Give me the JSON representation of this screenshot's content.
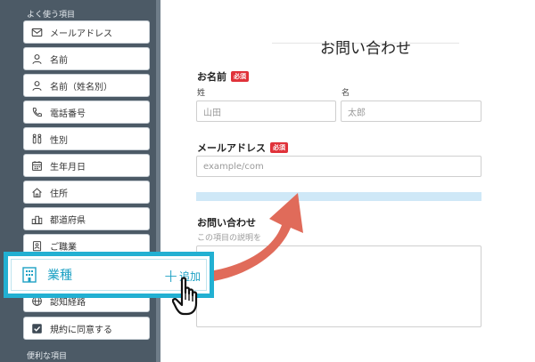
{
  "sidebar": {
    "frequent_heading": "よく使う項目",
    "useful_heading": "便利な項目",
    "items": [
      {
        "label": "メールアドレス",
        "icon": "mail-icon"
      },
      {
        "label": "名前",
        "icon": "person-icon"
      },
      {
        "label": "名前（姓名別）",
        "icon": "person-icon"
      },
      {
        "label": "電話番号",
        "icon": "phone-icon"
      },
      {
        "label": "性別",
        "icon": "gender-icon"
      },
      {
        "label": "生年月日",
        "icon": "calendar-icon"
      },
      {
        "label": "住所",
        "icon": "home-icon"
      },
      {
        "label": "都道府県",
        "icon": "city-icon"
      },
      {
        "label": "ご職業",
        "icon": "badge-icon"
      },
      {
        "label": "業種",
        "icon": "building-icon"
      },
      {
        "label": "認知経路",
        "icon": "globe-icon"
      },
      {
        "label": "規約に同意する",
        "icon": "checkbox-icon"
      }
    ]
  },
  "drag_card": {
    "label": "業種",
    "add_plus": "+",
    "add_label": "追加",
    "icon": "building-icon",
    "color": "#22b0d2"
  },
  "form": {
    "title": "お問い合わせ",
    "required_badge": "必須",
    "name": {
      "label": "お名前",
      "last_label": "姓",
      "first_label": "名",
      "last_placeholder": "山田",
      "first_placeholder": "太郎"
    },
    "email": {
      "label": "メールアドレス",
      "placeholder": "example/com"
    },
    "inquiry": {
      "label": "お問い合わせ",
      "help": "この項目の説明を"
    }
  },
  "colors": {
    "sidebar": "#4c5a66",
    "accent": "#22b0d2",
    "arrow": "#e06b5a",
    "required": "#e0323a"
  }
}
